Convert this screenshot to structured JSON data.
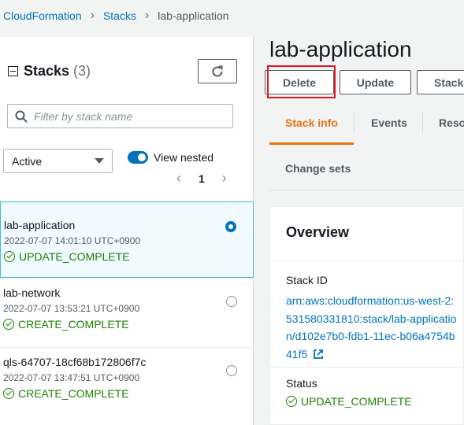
{
  "breadcrumb": [
    "CloudFormation",
    "Stacks",
    "lab-application"
  ],
  "panel": {
    "title": "Stacks",
    "count": "(3)",
    "filter_placeholder": "Filter by stack name",
    "status_filter": "Active",
    "view_nested_label": "View nested",
    "page": "1"
  },
  "stacks": [
    {
      "name": "lab-application",
      "time": "2022-07-07 14:01:10 UTC+0900",
      "status": "UPDATE_COMPLETE",
      "selected": true
    },
    {
      "name": "lab-network",
      "time": "2022-07-07 13:53:21 UTC+0900",
      "status": "CREATE_COMPLETE",
      "selected": false
    },
    {
      "name": "qls-64707-18cf68b172806f7c",
      "time": "2022-07-07 13:47:51 UTC+0900",
      "status": "CREATE_COMPLETE",
      "selected": false
    }
  ],
  "detail": {
    "title": "lab-application",
    "actions": {
      "delete": "Delete",
      "update": "Update",
      "stack_actions": "Stack"
    },
    "tabs": {
      "stack_info": "Stack info",
      "events": "Events",
      "resources": "Reso",
      "change_sets": "Change sets"
    },
    "overview": {
      "title": "Overview",
      "stack_id_label": "Stack ID",
      "stack_id": "arn:aws:cloudformation:us-west-2:531580331810:stack/lab-application/d102e7b0-fdb1-11ec-b06a4754b41f5",
      "status_label": "Status",
      "status": "UPDATE_COMPLETE"
    }
  },
  "colors": {
    "link": "#0073bb",
    "success": "#1d8102",
    "accent": "#ec7211",
    "highlight": "#e4151f"
  }
}
